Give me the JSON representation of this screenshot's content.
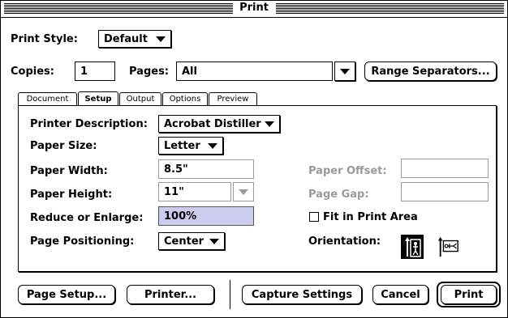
{
  "window": {
    "title": "Print"
  },
  "print_style": {
    "label": "Print Style:",
    "value": "Default"
  },
  "copies": {
    "label": "Copies:",
    "value": "1"
  },
  "pages": {
    "label": "Pages:",
    "value": "All"
  },
  "range_separators_label": "Range Separators...",
  "tabs": [
    {
      "label": "Document"
    },
    {
      "label": "Setup"
    },
    {
      "label": "Output"
    },
    {
      "label": "Options"
    },
    {
      "label": "Preview"
    }
  ],
  "setup": {
    "printer_description": {
      "label": "Printer Description:",
      "value": "Acrobat Distiller"
    },
    "paper_size": {
      "label": "Paper Size:",
      "value": "Letter"
    },
    "paper_width": {
      "label": "Paper Width:",
      "value": "8.5\""
    },
    "paper_height": {
      "label": "Paper Height:",
      "value": "11\""
    },
    "reduce_enlarge": {
      "label": "Reduce or Enlarge:",
      "value": "100%"
    },
    "page_positioning": {
      "label": "Page Positioning:",
      "value": "Center"
    },
    "paper_offset": {
      "label": "Paper Offset:",
      "value": ""
    },
    "page_gap": {
      "label": "Page Gap:",
      "value": ""
    },
    "fit_in_print_area": {
      "label": "Fit in Print Area",
      "checked": false
    },
    "orientation": {
      "label": "Orientation:",
      "selected": "portrait"
    }
  },
  "buttons": {
    "page_setup": "Page Setup...",
    "printer": "Printer...",
    "capture_settings": "Capture Settings",
    "cancel": "Cancel",
    "print": "Print"
  },
  "colors": {
    "selection": "#ccccee",
    "disabled": "#9a9a9a"
  }
}
